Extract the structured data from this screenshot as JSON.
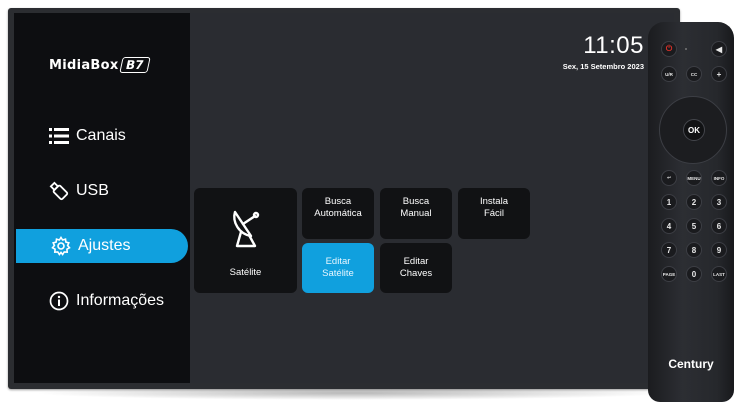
{
  "sidebar": {
    "logo_text": "MidiaBox",
    "logo_badge": "B7",
    "items": [
      {
        "label": "Canais"
      },
      {
        "label": "USB"
      },
      {
        "label": "Ajustes"
      },
      {
        "label": "Informações"
      }
    ],
    "active_index": 2
  },
  "clock": {
    "time": "11:05",
    "date": "Sex, 15 Setembro 2023"
  },
  "tiles": {
    "satellite": "Satélite",
    "auto_search": [
      "Busca",
      "Automática"
    ],
    "manual_search": [
      "Busca",
      "Manual"
    ],
    "easy_install": [
      "Instala",
      "Fácil"
    ],
    "edit_satellite": [
      "Editar",
      "Satélite"
    ],
    "edit_keys": [
      "Editar",
      "Chaves"
    ]
  },
  "remote": {
    "brand": "Century",
    "ok": "OK",
    "labels": [
      "U/R",
      "CC",
      "MENU",
      "INFO",
      "PAGE",
      "LAST",
      "1",
      "2",
      "3",
      "4",
      "5",
      "6",
      "7",
      "8",
      "9",
      "0"
    ]
  },
  "colors": {
    "accent": "#10a0de",
    "sidebar_bg": "#0d0e11",
    "content_bg": "#2a2c31",
    "tile_bg": "#111214"
  }
}
